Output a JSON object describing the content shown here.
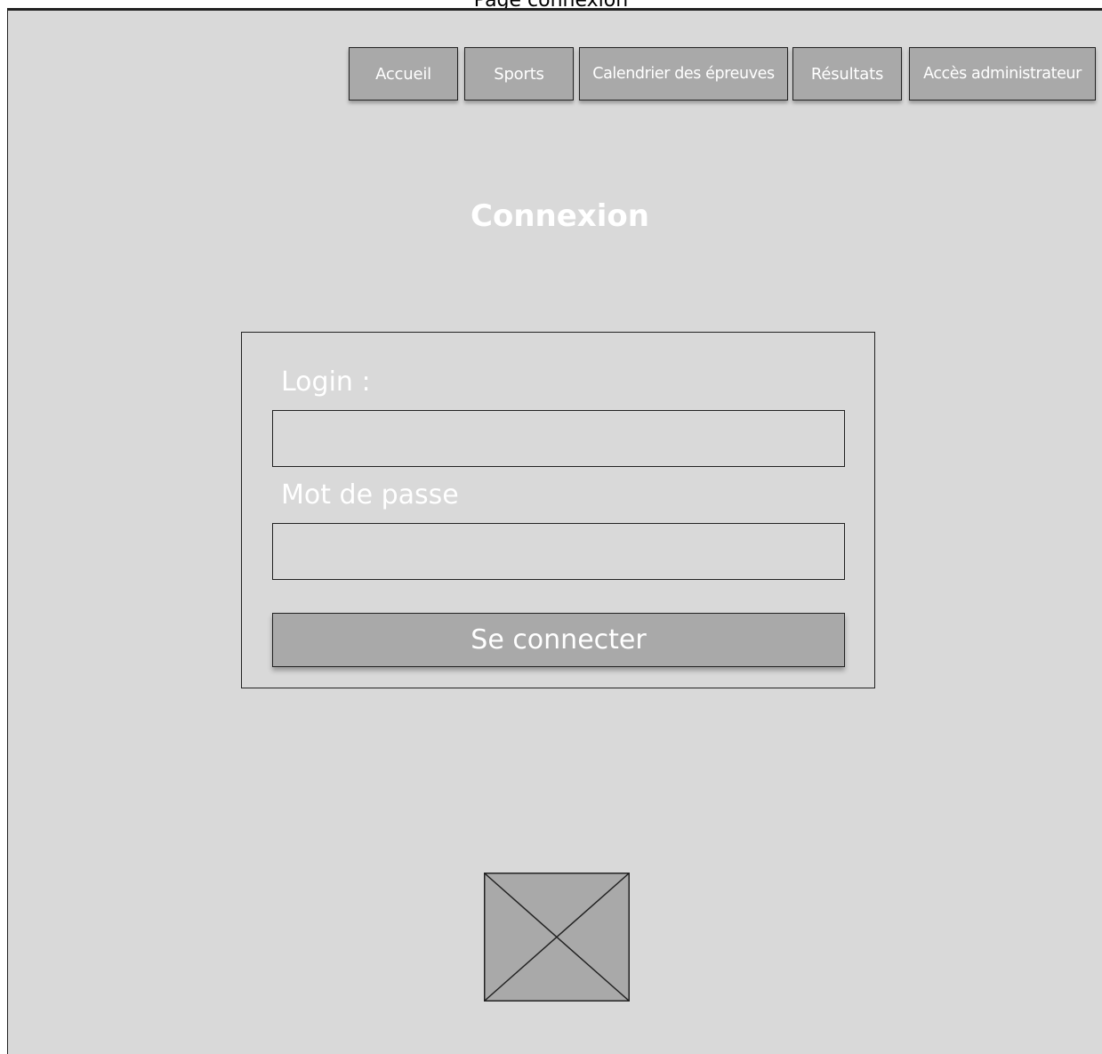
{
  "frame": {
    "title": "Page connexion"
  },
  "nav": {
    "items": [
      {
        "label": "Accueil"
      },
      {
        "label": "Sports"
      },
      {
        "label": "Calendrier des épreuves"
      },
      {
        "label": "Résultats"
      },
      {
        "label": "Accès administrateur"
      }
    ]
  },
  "main": {
    "title": "Connexion"
  },
  "form": {
    "login_label": "Login :",
    "login_value": "",
    "password_label": "Mot de passe",
    "password_value": "",
    "submit_label": "Se connecter"
  },
  "footer": {
    "image_icon": "image-placeholder-icon"
  },
  "colors": {
    "background": "#d9d9d9",
    "button": "#a9a9a9",
    "border": "#222222",
    "text": "#ffffff"
  }
}
